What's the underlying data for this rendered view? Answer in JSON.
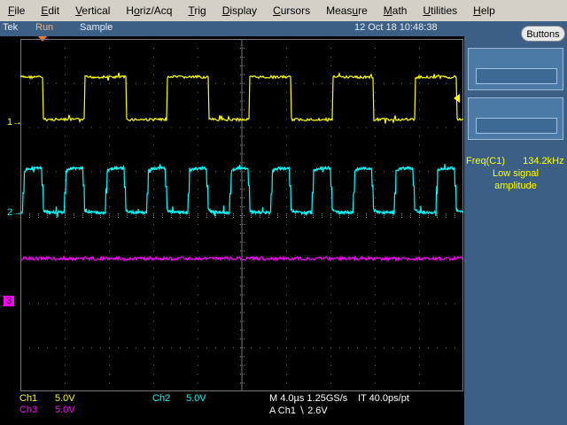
{
  "menu": [
    {
      "pre": "",
      "u": "F",
      "post": "ile"
    },
    {
      "pre": "",
      "u": "E",
      "post": "dit"
    },
    {
      "pre": "",
      "u": "V",
      "post": "ertical"
    },
    {
      "pre": "H",
      "u": "o",
      "post": "riz/Acq"
    },
    {
      "pre": "",
      "u": "T",
      "post": "rig"
    },
    {
      "pre": "",
      "u": "D",
      "post": "isplay"
    },
    {
      "pre": "",
      "u": "C",
      "post": "ursors"
    },
    {
      "pre": "Meas",
      "u": "u",
      "post": "re"
    },
    {
      "pre": "",
      "u": "M",
      "post": "ath"
    },
    {
      "pre": "",
      "u": "U",
      "post": "tilities"
    },
    {
      "pre": "",
      "u": "H",
      "post": "elp"
    }
  ],
  "status": {
    "brand": "Tek",
    "run": "Run",
    "mode": "Sample",
    "datetime": "12 Oct 18 10:48:38"
  },
  "panel": {
    "buttons_label": "Buttons",
    "meas_name": "Freq(C1)",
    "meas_value": "134.2kHz",
    "meas_note1": "Low signal",
    "meas_note2": "amplitude"
  },
  "markers": {
    "ch1": "1",
    "ch2": "2",
    "ch3": "3"
  },
  "readout": {
    "ch1_label": "Ch1",
    "ch1_scale": "5.0V",
    "ch2_label": "Ch2",
    "ch2_scale": "5.0V",
    "ch3_label": "Ch3",
    "ch3_scale": "5.0V",
    "horiz": "M 4.0µs 1.25GS/s",
    "interp": "IT 40.0ps/pt",
    "trigger": "A  Ch1  ∖  2.6V"
  },
  "colors": {
    "ch1": "#ffff00",
    "ch2": "#00ffff",
    "ch3": "#ff00ff",
    "trigger": "#ff7a1a",
    "panel": "#3c5f86"
  },
  "icons": {
    "trigger_position": "trigger-position-icon",
    "trigger_level": "trigger-level-icon"
  }
}
